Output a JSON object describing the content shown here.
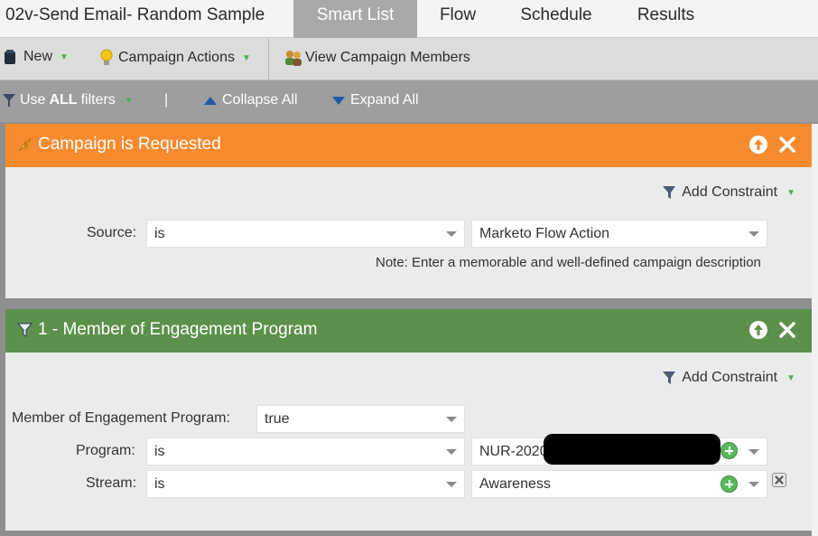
{
  "tabbar": {
    "title": "02v-Send Email- Random Sample",
    "tabs": {
      "smart_list": "Smart List",
      "flow": "Flow",
      "schedule": "Schedule",
      "results": "Results"
    }
  },
  "toolbar": {
    "new_label": "New",
    "campaign_actions_label": "Campaign Actions",
    "view_members_label": "View Campaign Members"
  },
  "filterbar": {
    "use_prefix": "Use",
    "use_bold": "ALL",
    "use_suffix": "filters",
    "separator": "|",
    "collapse_label": "Collapse All",
    "expand_label": "Expand All"
  },
  "filters": [
    {
      "title": "Campaign is Requested",
      "color": "#f68a2f",
      "add_constraint": "Add Constraint",
      "source_label": "Source:",
      "source_operator": "is",
      "source_value": "Marketo Flow Action",
      "note": "Note: Enter a memorable and well-defined campaign description"
    },
    {
      "title": "1 - Member of Engagement Program",
      "color": "#5b914b",
      "add_constraint": "Add Constraint",
      "member_label": "Member of Engagement Program:",
      "member_value": "true",
      "program_label": "Program:",
      "program_operator": "is",
      "program_value": "NUR-2020",
      "stream_label": "Stream:",
      "stream_operator": "is",
      "stream_value": "Awareness"
    }
  ]
}
